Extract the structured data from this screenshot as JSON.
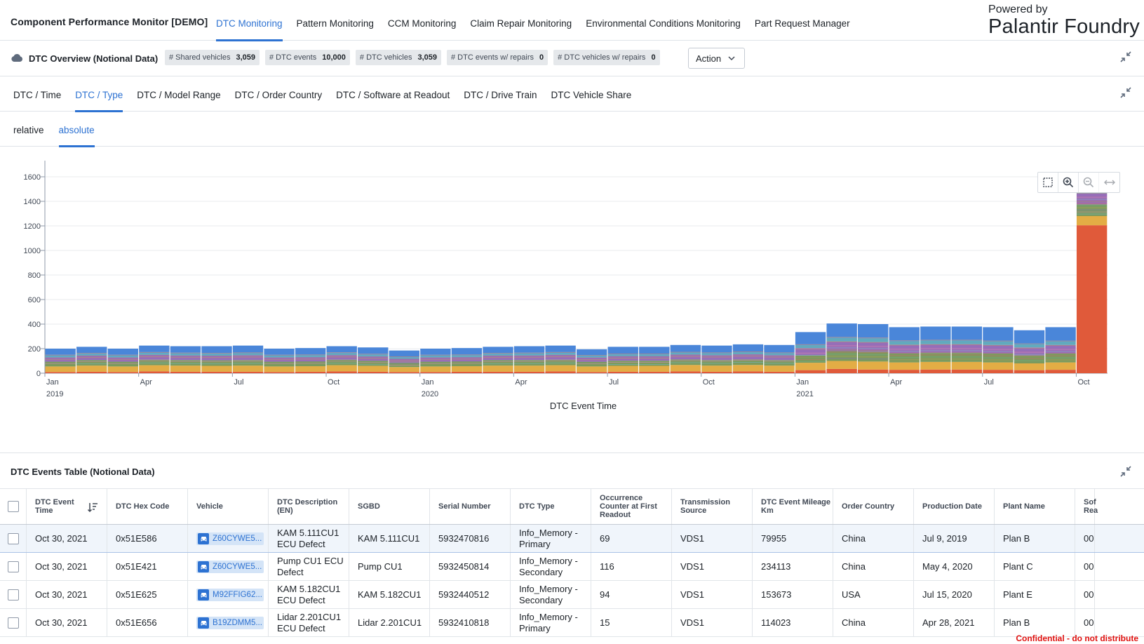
{
  "app": {
    "title": "Component Performance Monitor [DEMO]",
    "nav_tabs": [
      "DTC Monitoring",
      "Pattern Monitoring",
      "CCM Monitoring",
      "Claim Repair Monitoring",
      "Environmental Conditions Monitoring",
      "Part Request Manager"
    ],
    "active_nav": "DTC Monitoring",
    "brand_small": "Powered by",
    "brand_big": "Palantir Foundry",
    "accent": "#2d72d2"
  },
  "overview": {
    "title": "DTC Overview (Notional Data)",
    "stats": [
      {
        "label": "# Shared vehicles",
        "value": "3,059"
      },
      {
        "label": "# DTC events",
        "value": "10,000"
      },
      {
        "label": "# DTC vehicles",
        "value": "3,059"
      },
      {
        "label": "# DTC events w/ repairs",
        "value": "0"
      },
      {
        "label": "# DTC vehicles w/ repairs",
        "value": "0"
      }
    ],
    "action_label": "Action"
  },
  "subtabs": [
    "DTC / Time",
    "DTC / Type",
    "DTC / Model Range",
    "DTC / Order Country",
    "DTC / Software at Readout",
    "DTC / Drive Train",
    "DTC Vehicle Share"
  ],
  "active_subtab": "DTC / Type",
  "modetabs": [
    "relative",
    "absolute"
  ],
  "active_mode": "absolute",
  "chart_data": {
    "type": "bar",
    "stacked": true,
    "xlabel": "DTC Event Time",
    "ylabel": "",
    "ylim": [
      0,
      1650
    ],
    "yticks": [
      0,
      200,
      400,
      600,
      800,
      1000,
      1200,
      1400,
      1600
    ],
    "xtick_labels": [
      {
        "month": "Jan",
        "year": "2019",
        "index": 0
      },
      {
        "month": "Apr",
        "year": "",
        "index": 3
      },
      {
        "month": "Jul",
        "year": "",
        "index": 6
      },
      {
        "month": "Oct",
        "year": "",
        "index": 9
      },
      {
        "month": "Jan",
        "year": "2020",
        "index": 12
      },
      {
        "month": "Apr",
        "year": "",
        "index": 15
      },
      {
        "month": "Jul",
        "year": "",
        "index": 18
      },
      {
        "month": "Oct",
        "year": "",
        "index": 21
      },
      {
        "month": "Jan",
        "year": "2021",
        "index": 24
      },
      {
        "month": "Apr",
        "year": "",
        "index": 27
      },
      {
        "month": "Jul",
        "year": "",
        "index": 30
      },
      {
        "month": "Oct",
        "year": "",
        "index": 33
      }
    ],
    "x": [
      "2019-01",
      "2019-02",
      "2019-03",
      "2019-04",
      "2019-05",
      "2019-06",
      "2019-07",
      "2019-08",
      "2019-09",
      "2019-10",
      "2019-11",
      "2019-12",
      "2020-01",
      "2020-02",
      "2020-03",
      "2020-04",
      "2020-05",
      "2020-06",
      "2020-07",
      "2020-08",
      "2020-09",
      "2020-10",
      "2020-11",
      "2020-12",
      "2021-01",
      "2021-02",
      "2021-03",
      "2021-04",
      "2021-05",
      "2021-06",
      "2021-07",
      "2021-08",
      "2021-09",
      "2021-10"
    ],
    "totals": [
      200,
      215,
      200,
      225,
      220,
      220,
      225,
      200,
      205,
      220,
      210,
      185,
      200,
      205,
      215,
      220,
      225,
      195,
      215,
      215,
      230,
      225,
      235,
      230,
      335,
      405,
      400,
      375,
      380,
      380,
      375,
      350,
      375,
      1580
    ],
    "series": [
      {
        "color": "#e05a3a",
        "values": [
          10,
          12,
          10,
          15,
          12,
          12,
          12,
          10,
          12,
          15,
          12,
          10,
          10,
          12,
          12,
          12,
          15,
          10,
          12,
          12,
          15,
          12,
          15,
          12,
          25,
          35,
          30,
          28,
          30,
          30,
          28,
          25,
          28,
          1205
        ]
      },
      {
        "color": "#e3ad45",
        "values": [
          45,
          50,
          45,
          50,
          50,
          48,
          50,
          45,
          45,
          50,
          48,
          40,
          45,
          45,
          50,
          50,
          50,
          45,
          48,
          48,
          52,
          50,
          52,
          50,
          60,
          65,
          65,
          60,
          62,
          62,
          60,
          55,
          60,
          75
        ]
      },
      {
        "color": "#7b9a5e",
        "values": [
          40,
          45,
          40,
          45,
          45,
          45,
          45,
          40,
          40,
          45,
          42,
          38,
          40,
          40,
          45,
          45,
          45,
          40,
          42,
          42,
          45,
          45,
          45,
          45,
          60,
          80,
          80,
          72,
          72,
          72,
          72,
          65,
          72,
          95
        ]
      },
      {
        "color": "#9b6db5",
        "values": [
          35,
          38,
          35,
          40,
          38,
          38,
          40,
          35,
          35,
          38,
          36,
          32,
          35,
          35,
          38,
          38,
          40,
          35,
          38,
          38,
          40,
          40,
          42,
          40,
          60,
          78,
          78,
          72,
          72,
          72,
          70,
          65,
          70,
          90
        ]
      },
      {
        "color": "#5fa8c9",
        "values": [
          20,
          20,
          20,
          22,
          22,
          22,
          22,
          20,
          20,
          22,
          20,
          17,
          20,
          20,
          20,
          22,
          22,
          18,
          20,
          20,
          22,
          22,
          23,
          22,
          30,
          37,
          37,
          35,
          36,
          36,
          35,
          32,
          35,
          40
        ]
      },
      {
        "color": "#4a86d9",
        "values": [
          50,
          50,
          50,
          53,
          53,
          55,
          56,
          50,
          53,
          50,
          52,
          48,
          50,
          53,
          50,
          53,
          53,
          47,
          55,
          55,
          56,
          56,
          58,
          61,
          100,
          110,
          110,
          108,
          108,
          108,
          110,
          108,
          110,
          75
        ]
      }
    ]
  },
  "table": {
    "title": "DTC Events Table (Notional Data)",
    "columns": [
      "DTC Event Time",
      "DTC Hex Code",
      "Vehicle",
      "DTC Description (EN)",
      "SGBD",
      "Serial Number",
      "DTC Type",
      "Occurrence Counter at First Readout",
      "Transmission Source",
      "DTC Event Mileage Km",
      "Order Country",
      "Production Date",
      "Plant Name",
      "Sof Rea"
    ],
    "rows": [
      {
        "time": "Oct 30, 2021",
        "hex": "0x51E586",
        "vehicle": "Z60CYWE5...",
        "desc": "KAM 5.111CU1 ECU Defect",
        "sgbd": "KAM 5.111CU1",
        "serial": "5932470816",
        "type": "Info_Memory - Primary",
        "occ": "69",
        "source": "VDS1",
        "mileage": "79955",
        "country": "China",
        "prod": "Jul 9, 2019",
        "plant": "Plan B",
        "sw": "00"
      },
      {
        "time": "Oct 30, 2021",
        "hex": "0x51E421",
        "vehicle": "Z60CYWE5...",
        "desc": "Pump CU1 ECU Defect",
        "sgbd": "Pump CU1",
        "serial": "5932450814",
        "type": "Info_Memory - Secondary",
        "occ": "116",
        "source": "VDS1",
        "mileage": "234113",
        "country": "China",
        "prod": "May 4, 2020",
        "plant": "Plant C",
        "sw": "00"
      },
      {
        "time": "Oct 30, 2021",
        "hex": "0x51E625",
        "vehicle": "M92FFIG62...",
        "desc": "KAM 5.182CU1 ECU Defect",
        "sgbd": "KAM 5.182CU1",
        "serial": "5932440512",
        "type": "Info_Memory - Secondary",
        "occ": "94",
        "source": "VDS1",
        "mileage": "153673",
        "country": "USA",
        "prod": "Jul 15, 2020",
        "plant": "Plant E",
        "sw": "00"
      },
      {
        "time": "Oct 30, 2021",
        "hex": "0x51E656",
        "vehicle": "B19ZDMM5...",
        "desc": "Lidar 2.201CU1 ECU Defect",
        "sgbd": "Lidar 2.201CU1",
        "serial": "5932410818",
        "type": "Info_Memory - Primary",
        "occ": "15",
        "source": "VDS1",
        "mileage": "114023",
        "country": "China",
        "prod": "Apr 28, 2021",
        "plant": "Plan B",
        "sw": "00"
      }
    ]
  },
  "footer": {
    "confidential": "Confidential - do not distribute"
  }
}
